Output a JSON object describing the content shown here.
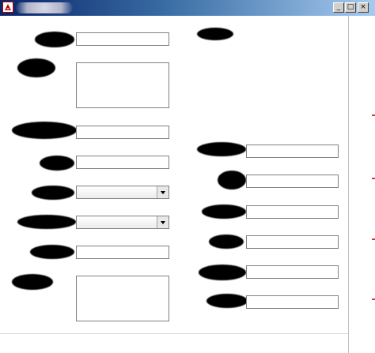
{
  "window": {
    "title": ""
  },
  "controls": {
    "minimize": "_",
    "maximize": "□",
    "close": "×"
  },
  "left_form": {
    "field_1": "",
    "notes_1": "",
    "field_2": "",
    "field_3": "",
    "select_1": "",
    "select_2": "",
    "field_4": "",
    "notes_2": ""
  },
  "right_form": {
    "field_1": "",
    "field_2": "",
    "field_3": "",
    "field_4": "",
    "field_5": "",
    "field_6": ""
  },
  "colors": {
    "titlebar_start": "#0a246a",
    "titlebar_end": "#a6caf0",
    "field_border": "#7f7f7f"
  }
}
